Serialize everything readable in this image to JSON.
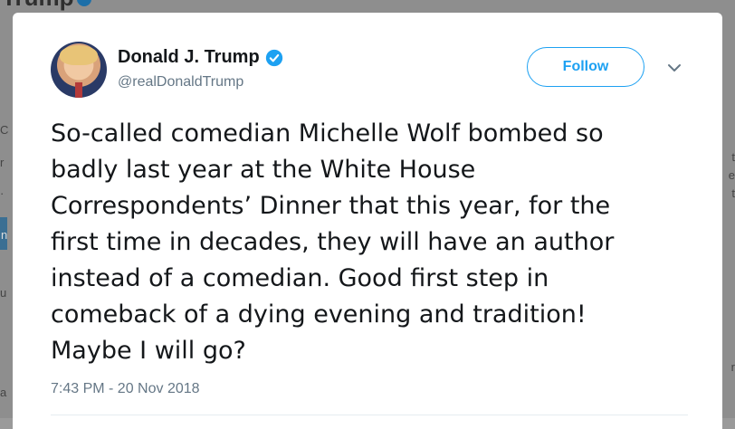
{
  "background": {
    "top_name": "Trump",
    "edge_glyphs_left": [
      "C",
      "r",
      "·",
      "n",
      "u",
      "a"
    ],
    "edge_glyphs_right": [
      "t",
      "e",
      "t",
      "r"
    ]
  },
  "tweet": {
    "display_name": "Donald J. Trump",
    "handle": "@realDonaldTrump",
    "follow_label": "Follow",
    "text": "So-called comedian Michelle Wolf bombed so\nbadly last year at the White House\nCorrespondents’ Dinner that this year, for the\nfirst time in decades, they will have an author\ninstead of a comedian. Good first step in\ncomeback of a dying evening and tradition!\nMaybe I will go?",
    "timestamp": "7:43 PM - 20 Nov 2018"
  },
  "colors": {
    "accent": "#1da1f2",
    "secondary_text": "#657786",
    "primary_text": "#14171a",
    "backdrop": "#8e8e8e"
  },
  "icons": {
    "verified": "verified-badge-icon",
    "menu": "chevron-down-icon"
  }
}
